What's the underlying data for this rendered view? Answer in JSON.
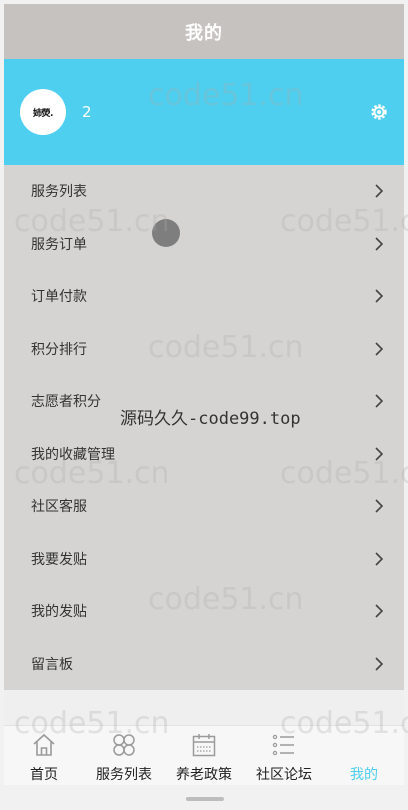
{
  "header": {
    "title": "我的"
  },
  "profile": {
    "avatar_text": "姉熒.",
    "name": "2"
  },
  "menu": [
    {
      "label": "服务列表"
    },
    {
      "label": "服务订单"
    },
    {
      "label": "订单付款"
    },
    {
      "label": "积分排行"
    },
    {
      "label": "志愿者积分"
    },
    {
      "label": "我的收藏管理"
    },
    {
      "label": "社区客服"
    },
    {
      "label": "我要发贴"
    },
    {
      "label": "我的发贴"
    },
    {
      "label": "留言板"
    }
  ],
  "tabs": [
    {
      "label": "首页",
      "icon": "home-icon"
    },
    {
      "label": "服务列表",
      "icon": "flower-icon"
    },
    {
      "label": "养老政策",
      "icon": "calendar-icon"
    },
    {
      "label": "社区论坛",
      "icon": "list-icon"
    },
    {
      "label": "我的",
      "icon": "person-icon",
      "active": true
    }
  ],
  "watermarks": {
    "repeat": "code51.cn",
    "center": "源码久久-code99.top"
  },
  "colors": {
    "accent": "#4ecfef",
    "header": "#c6c2c0",
    "menu_bg": "#d6d4d3"
  }
}
